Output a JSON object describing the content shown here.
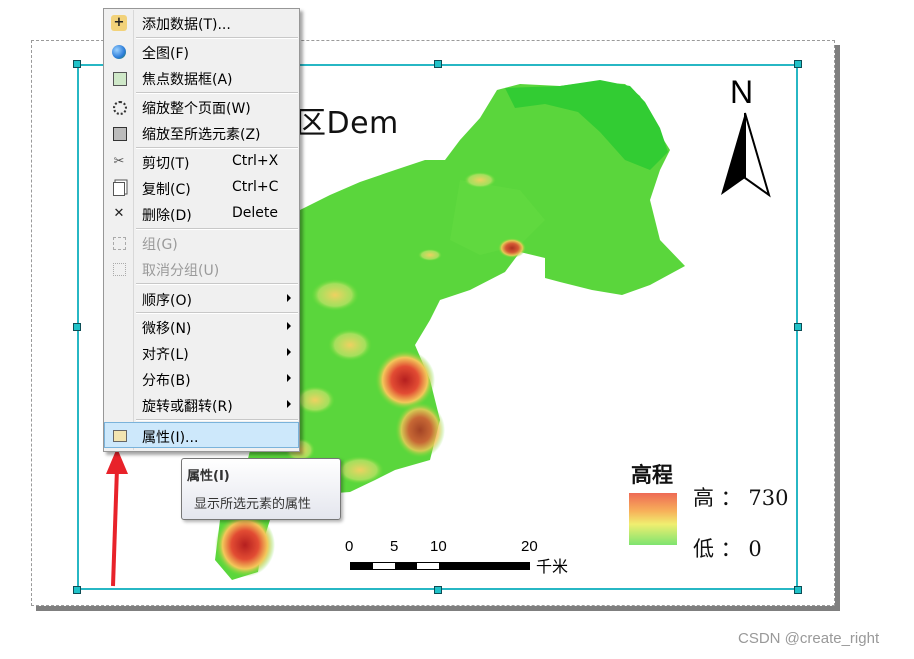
{
  "map": {
    "title": "区Dem",
    "north_label": "N",
    "legend": {
      "title": "高程",
      "high_label": "高 ： 730",
      "low_label": "低 ： 0",
      "ramp_colors": [
        "#ee6a55",
        "#f7b15a",
        "#f0ee70",
        "#7ee470"
      ]
    },
    "scale_bar": {
      "ticks": [
        "0",
        "5",
        "10",
        "20"
      ],
      "unit": "千米"
    },
    "colors": {
      "frame": "#27b7c4",
      "terrain_low": "#33cc33",
      "terrain_high": "#cc2222"
    }
  },
  "context_menu": {
    "items": [
      {
        "label": "添加数据(T)...",
        "shortcut": "",
        "icon": "add-data-icon"
      },
      {
        "label": "全图(F)",
        "shortcut": "",
        "icon": "globe-icon"
      },
      {
        "label": "焦点数据框(A)",
        "shortcut": "",
        "icon": "focus-frame-icon"
      },
      {
        "label": "缩放整个页面(W)",
        "shortcut": "",
        "icon": "zoom-page-icon"
      },
      {
        "label": "缩放至所选元素(Z)",
        "shortcut": "",
        "icon": "zoom-selected-icon"
      },
      {
        "label": "剪切(T)",
        "shortcut": "Ctrl+X",
        "icon": "scissors-icon"
      },
      {
        "label": "复制(C)",
        "shortcut": "Ctrl+C",
        "icon": "copy-icon"
      },
      {
        "label": "删除(D)",
        "shortcut": "Delete",
        "icon": "delete-icon"
      },
      {
        "label": "组(G)",
        "shortcut": "",
        "icon": "group-icon"
      },
      {
        "label": "取消分组(U)",
        "shortcut": "",
        "icon": "ungroup-icon"
      },
      {
        "label": "顺序(O)",
        "shortcut": "",
        "icon": ""
      },
      {
        "label": "微移(N)",
        "shortcut": "",
        "icon": ""
      },
      {
        "label": "对齐(L)",
        "shortcut": "",
        "icon": ""
      },
      {
        "label": "分布(B)",
        "shortcut": "",
        "icon": ""
      },
      {
        "label": "旋转或翻转(R)",
        "shortcut": "",
        "icon": ""
      },
      {
        "label": "属性(I)...",
        "shortcut": "",
        "icon": "properties-icon"
      }
    ]
  },
  "tooltip": {
    "title": "属性(I)",
    "description": "显示所选元素的属性"
  },
  "watermark": "CSDN @create_right"
}
